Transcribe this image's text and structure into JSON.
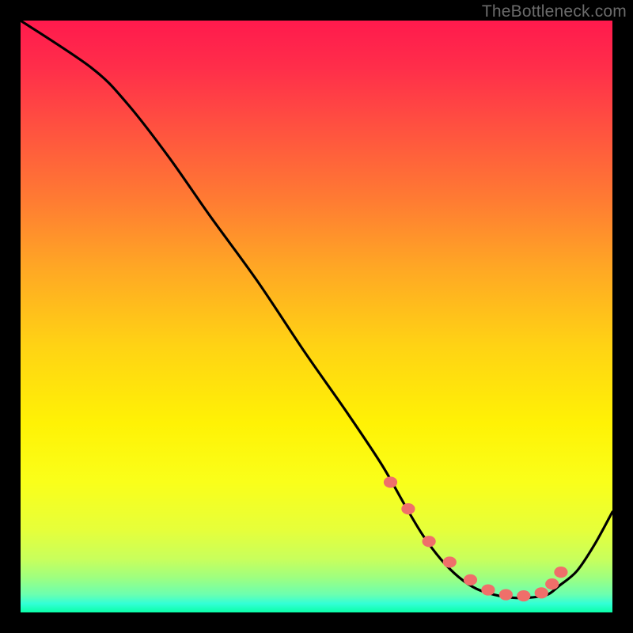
{
  "attribution": "TheBottleneck.com",
  "chart_data": {
    "type": "line",
    "title": "",
    "xlabel": "",
    "ylabel": "",
    "xlim": [
      0,
      100
    ],
    "ylim": [
      0,
      100
    ],
    "curve": {
      "x": [
        0,
        12,
        18,
        25,
        32,
        40,
        48,
        55,
        61,
        65,
        68,
        71,
        74,
        77,
        80,
        83,
        86,
        89,
        91,
        94,
        97,
        100
      ],
      "y": [
        100,
        92,
        86,
        77,
        67,
        56,
        44,
        34,
        25,
        18,
        13,
        9,
        6,
        4,
        3,
        2.5,
        2.5,
        3,
        4.5,
        7,
        11.5,
        17
      ]
    },
    "markers": {
      "x": [
        62.5,
        65.5,
        69,
        72.5,
        76,
        79,
        82,
        85,
        88,
        89.8,
        91.3
      ],
      "y": [
        22,
        17.5,
        12,
        8.5,
        5.5,
        3.8,
        3,
        2.8,
        3.3,
        4.8,
        6.8
      ]
    },
    "marker_color": "#ef6f6a",
    "curve_color": "#000000"
  }
}
